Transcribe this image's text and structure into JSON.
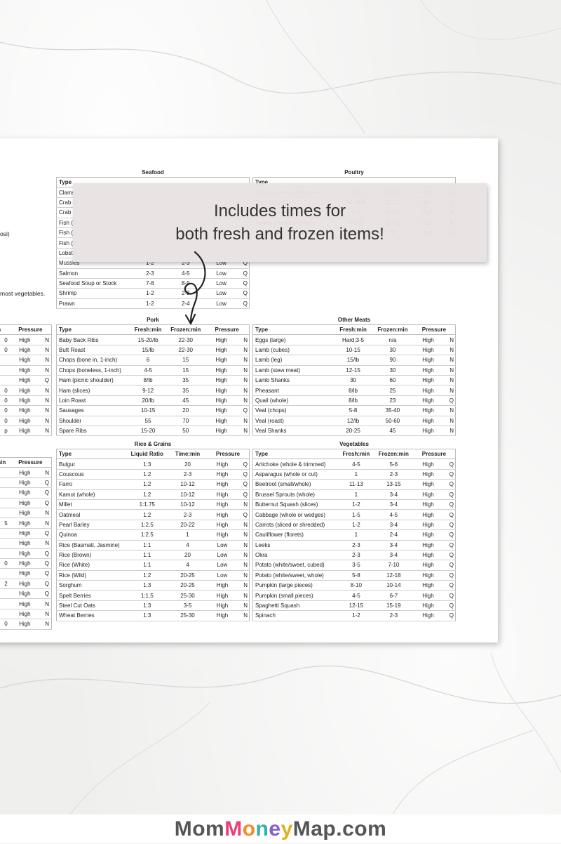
{
  "callout": {
    "line1": "Includes times for",
    "line2": "both fresh and frozen items!"
  },
  "footer": {
    "part1": "Mom",
    "part2": "Money",
    "part3": "Map.com",
    "colors": {
      "mom": "#555555",
      "money_m": "#e8407a",
      "money_o": "#f28c28",
      "money_n": "#2fb4a8",
      "money_e": "#8a5cc7",
      "money_y": "#e0b020",
      "map": "#555555"
    }
  },
  "left_edge": {
    "text_osi": "osi)",
    "text_veg": "most vegetables.",
    "pressure_rows_mid": [
      "0",
      "0",
      "",
      "",
      "",
      "0",
      "0",
      "0",
      "0",
      "p"
    ],
    "pressure_rows_bot": [
      "",
      "",
      "",
      "",
      "",
      "5",
      "",
      "",
      "",
      "0",
      "2",
      "",
      "",
      "0"
    ]
  },
  "seafood": {
    "title": "Seafood",
    "header": [
      "Type",
      "",
      "",
      ""
    ],
    "rows": [
      [
        "Clams",
        "",
        "",
        "",
        ""
      ],
      [
        "Crab (v",
        "",
        "",
        "",
        ""
      ],
      [
        "Crab L",
        "",
        "",
        "",
        ""
      ],
      [
        "Fish (fi",
        "",
        "",
        "",
        ""
      ],
      [
        "Fish (s",
        "",
        "",
        "",
        ""
      ],
      [
        "Fish (w",
        "",
        "",
        "",
        ""
      ],
      [
        "Lobste",
        "",
        "",
        "",
        ""
      ],
      [
        "Mussles",
        "1-2",
        "2-3",
        "Low",
        "Q"
      ],
      [
        "Salmon",
        "2-3",
        "4-5",
        "Low",
        "Q"
      ],
      [
        "Seafood Soup or Stock",
        "7-8",
        "8-9",
        "Low",
        "Q"
      ],
      [
        "Shrimp",
        "1-2",
        "2-3",
        "Low",
        "Q"
      ],
      [
        "Prawn",
        "1-2",
        "2-4",
        "Low",
        "Q"
      ]
    ]
  },
  "poultry": {
    "title": "Poultry",
    "header": [
      "Type",
      "",
      "",
      ""
    ],
    "rows": [
      [
        "Duck (portions with bones)",
        "12-15",
        "22-30",
        "High",
        "Q"
      ],
      [
        "Duck (whole)",
        "10-15/lb",
        "20-25",
        "High",
        "Q"
      ],
      [
        "Turkey (breast, boneless)",
        "7-9",
        "50-65",
        "High",
        "N"
      ],
      [
        "Turkey (breast, whole)",
        "20-25",
        "50-65",
        "High",
        "N"
      ],
      [
        "Turkey Leg (drumsticks)",
        "15-20",
        "30",
        "High",
        "N"
      ]
    ]
  },
  "pork": {
    "title": "Pork",
    "header": [
      "Type",
      "Fresh:min",
      "Frozen:min",
      "Pressure"
    ],
    "rows": [
      [
        "Baby Back Ribs",
        "15-20/lb",
        "22-30",
        "High",
        "N"
      ],
      [
        "Butt Roast",
        "15/lb",
        "22-30",
        "High",
        "N"
      ],
      [
        "Chops (bone in, 1-inch)",
        "6",
        "15",
        "High",
        "N"
      ],
      [
        "Chops (boneless, 1-inch)",
        "4-5",
        "15",
        "High",
        "N"
      ],
      [
        "Ham (picnic shoulder)",
        "8/lb",
        "35",
        "High",
        "N"
      ],
      [
        "Ham (slices)",
        "9-12",
        "35",
        "High",
        "N"
      ],
      [
        "Loin Roast",
        "20/lb",
        "45",
        "High",
        "N"
      ],
      [
        "Sausages",
        "10-15",
        "20",
        "High",
        "Q"
      ],
      [
        "Shoulder",
        "55",
        "70",
        "High",
        "N"
      ],
      [
        "Spare Ribs",
        "15-20",
        "50",
        "High",
        "N"
      ]
    ]
  },
  "other_meats": {
    "title": "Other Meats",
    "header": [
      "Type",
      "Fresh:min",
      "Frozen:min",
      "Pressure"
    ],
    "rows": [
      [
        "Eggs (large)",
        "Hard:3-5",
        "n/a",
        "High",
        "N"
      ],
      [
        "Lamb (cubes)",
        "10-15",
        "30",
        "High",
        "N"
      ],
      [
        "Lamb (leg)",
        "15/lb",
        "90",
        "High",
        "N"
      ],
      [
        "Lamb (stew meat)",
        "12-15",
        "30",
        "High",
        "N"
      ],
      [
        "Lamb Shanks",
        "30",
        "60",
        "High",
        "N"
      ],
      [
        "Pheasant",
        "8/lb",
        "25",
        "High",
        "N"
      ],
      [
        "Quail (whole)",
        "8/lb",
        "23",
        "High",
        "Q"
      ],
      [
        "Veal (chops)",
        "5-8",
        "35-40",
        "High",
        "N"
      ],
      [
        "Veal (roast)",
        "12/lb",
        "50-60",
        "High",
        "N"
      ],
      [
        "Veal Shanks",
        "20-25",
        "45",
        "High",
        "N"
      ]
    ]
  },
  "rice_grains": {
    "title": "Rice & Grains",
    "header": [
      "Type",
      "Liquid Ratio",
      "Time:min",
      "Pressure"
    ],
    "rows": [
      [
        "Bulgur",
        "1:3",
        "20",
        "High",
        "Q"
      ],
      [
        "Couscous",
        "1:2",
        "2-3",
        "High",
        "Q"
      ],
      [
        "Farro",
        "1:2",
        "10-12",
        "High",
        "Q"
      ],
      [
        "Kamut (whole)",
        "1:2",
        "10-12",
        "High",
        "Q"
      ],
      [
        "Millet",
        "1:1.75",
        "10-12",
        "High",
        "N"
      ],
      [
        "Oatmeal",
        "1:2",
        "2-3",
        "High",
        "Q"
      ],
      [
        "Pearl Barley",
        "1:2.5",
        "20-22",
        "High",
        "N"
      ],
      [
        "Quinoa",
        "1:2.5",
        "1",
        "High",
        "N"
      ],
      [
        "Rice (Basmati, Jasmine)",
        "1:1",
        "4",
        "Low",
        "N"
      ],
      [
        "Rice (Brown)",
        "1:1",
        "20",
        "Low",
        "N"
      ],
      [
        "Rice (White)",
        "1:1",
        "4",
        "Low",
        "N"
      ],
      [
        "Rice (Wild)",
        "1:2",
        "20-25",
        "Low",
        "N"
      ],
      [
        "Sorghum",
        "1:3",
        "20-25",
        "High",
        "N"
      ],
      [
        "Spelt Berries",
        "1:1.5",
        "25-30",
        "High",
        "N"
      ],
      [
        "Steel Cut Oats",
        "1:3",
        "3-5",
        "High",
        "N"
      ],
      [
        "Wheat Berries",
        "1:3",
        "25-30",
        "High",
        "N"
      ]
    ]
  },
  "vegetables": {
    "title": "Vegetables",
    "header": [
      "Type",
      "Fresh:min",
      "Frozen:min",
      "Pressure"
    ],
    "rows": [
      [
        "Artichoke (whole & trimmed)",
        "4-5",
        "5-6",
        "High",
        "Q"
      ],
      [
        "Asparagus (whole or cut)",
        "1",
        "2-3",
        "High",
        "Q"
      ],
      [
        "Beetroot (small/whole)",
        "11-13",
        "13-15",
        "High",
        "Q"
      ],
      [
        "Brussel Sprouts (whole)",
        "1",
        "3-4",
        "High",
        "Q"
      ],
      [
        "Butternut Squash (slices)",
        "1-2",
        "3-4",
        "High",
        "Q"
      ],
      [
        "Cabbage (whole or wedges)",
        "1-5",
        "4-5",
        "High",
        "Q"
      ],
      [
        "Carrots (sliced or shredded)",
        "1-2",
        "3-4",
        "High",
        "Q"
      ],
      [
        "Cauliflower (florets)",
        "1",
        "2-4",
        "High",
        "Q"
      ],
      [
        "Leeks",
        "2-3",
        "3-4",
        "High",
        "Q"
      ],
      [
        "Okra",
        "2-3",
        "3-4",
        "High",
        "Q"
      ],
      [
        "Potato (white/sweet, cubed)",
        "3-5",
        "7-10",
        "High",
        "Q"
      ],
      [
        "Potato (white/sweet, whole)",
        "5-8",
        "12-18",
        "High",
        "Q"
      ],
      [
        "Pumpkin (large pieces)",
        "8-10",
        "10-14",
        "High",
        "Q"
      ],
      [
        "Pumpkin (small pieces)",
        "4-5",
        "6-7",
        "High",
        "Q"
      ],
      [
        "Spaghetti Squash",
        "12-15",
        "15-19",
        "High",
        "Q"
      ],
      [
        "Spinach",
        "1-2",
        "2-3",
        "High",
        "Q"
      ]
    ]
  },
  "left_pressure": {
    "header_mid": [
      "in",
      "Pressure"
    ],
    "header_bot": [
      "min",
      "Pressure"
    ],
    "mid_rows": [
      [
        "0",
        "High",
        "N"
      ],
      [
        "0",
        "High",
        "N"
      ],
      [
        "",
        "High",
        "N"
      ],
      [
        "",
        "High",
        "N"
      ],
      [
        "",
        "High",
        "Q"
      ],
      [
        "0",
        "High",
        "N"
      ],
      [
        "0",
        "High",
        "N"
      ],
      [
        "0",
        "High",
        "N"
      ],
      [
        "0",
        "High",
        "N"
      ],
      [
        "p",
        "High",
        "N"
      ]
    ],
    "bot_rows": [
      [
        "",
        "High",
        "N"
      ],
      [
        "",
        "High",
        "Q"
      ],
      [
        "",
        "High",
        "Q"
      ],
      [
        "",
        "High",
        "Q"
      ],
      [
        "",
        "High",
        "N"
      ],
      [
        "5",
        "High",
        "N"
      ],
      [
        "",
        "High",
        "Q"
      ],
      [
        "",
        "High",
        "N"
      ],
      [
        "",
        "High",
        "Q"
      ],
      [
        "0",
        "High",
        "Q"
      ],
      [
        "",
        "High",
        "Q"
      ],
      [
        "2",
        "High",
        "Q"
      ],
      [
        "",
        "High",
        "Q"
      ],
      [
        "",
        "High",
        "N"
      ],
      [
        "",
        "High",
        "N"
      ],
      [
        "0",
        "High",
        "N"
      ]
    ]
  }
}
